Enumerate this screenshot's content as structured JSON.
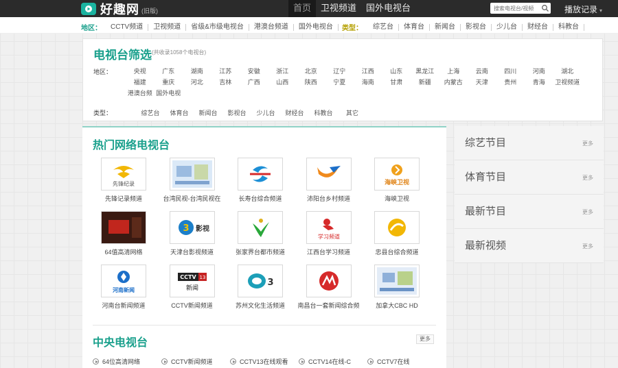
{
  "header": {
    "logo_text": "好趣网",
    "logo_tag": "(旧版)",
    "nav": [
      "首页",
      "卫视频道",
      "国外电视台"
    ],
    "search_placeholder": "搜索电视台/视频",
    "history": "播放记录"
  },
  "filterbar": {
    "region_label": "地区：",
    "regions": [
      "CCTV频道",
      "卫视频道",
      "省级&市级电视台",
      "港澳台频道",
      "国外电视台"
    ],
    "type_label": "类型：",
    "types": [
      "综艺台",
      "体育台",
      "新闻台",
      "影视台",
      "少儿台",
      "财经台",
      "科教台"
    ]
  },
  "panel": {
    "title": "电视台筛选",
    "count": "(共收录1058个电视台)",
    "region_label": "地区：",
    "region_rows": [
      [
        "央视",
        "广东",
        "湖南",
        "江苏",
        "安徽",
        "浙江",
        "北京",
        "辽宁",
        "江西",
        "山东",
        "黑龙江",
        "上海",
        "云南",
        "四川",
        "河南",
        "湖北"
      ],
      [
        "福建",
        "重庆",
        "河北",
        "吉林",
        "广西",
        "山西",
        "陕西",
        "宁夏",
        "海南",
        "甘肃",
        "新疆",
        "内蒙古",
        "天津",
        "贵州",
        "青海",
        "卫视频道"
      ],
      [
        "港澳台频",
        "国外电视"
      ]
    ],
    "type_label": "类型：",
    "types": [
      "综艺台",
      "体育台",
      "新闻台",
      "影视台",
      "少儿台",
      "财经台",
      "科教台",
      "其它"
    ]
  },
  "hot": {
    "title": "热门网络电视台",
    "items": [
      {
        "label": "先锋记录频道",
        "logo": "先锋纪录"
      },
      {
        "label": "台湾民视-台湾民视在",
        "logo": ""
      },
      {
        "label": "长寿台综合频道",
        "logo": ""
      },
      {
        "label": "沛阳台乡村频道",
        "logo": ""
      },
      {
        "label": "海峡卫视",
        "logo": "海峡卫视"
      },
      {
        "label": "64值高清网络",
        "logo": ""
      },
      {
        "label": "天津台影视频道",
        "logo": "影视"
      },
      {
        "label": "张家界台都市频道",
        "logo": ""
      },
      {
        "label": "江西台学习频道",
        "logo": "学习频道"
      },
      {
        "label": "忠县台综合频道",
        "logo": ""
      },
      {
        "label": "河南台新闻频道",
        "logo": "河南新闻"
      },
      {
        "label": "CCTV新闻频道",
        "logo": "新闻"
      },
      {
        "label": "苏州文化生活频道",
        "logo": "3"
      },
      {
        "label": "南昌台一套新闻综合频",
        "logo": ""
      },
      {
        "label": "加拿大CBC HD",
        "logo": ""
      }
    ]
  },
  "cctv": {
    "title": "中央电视台",
    "more": "更多",
    "items": [
      "64位高清网络",
      "CCTV新闻频道",
      "CCTV13在线观看",
      "CCTV14在线-C",
      "CCTV7在线"
    ]
  },
  "sidebar": {
    "items": [
      {
        "title": "综艺节目",
        "more": "更多"
      },
      {
        "title": "体育节目",
        "more": "更多"
      },
      {
        "title": "最新节目",
        "more": "更多"
      },
      {
        "title": "最新视频",
        "more": "更多"
      }
    ]
  },
  "colors": {
    "accent": "#1aa08c",
    "topbar": "#2b2b2b",
    "type_label": "#b5a000"
  }
}
